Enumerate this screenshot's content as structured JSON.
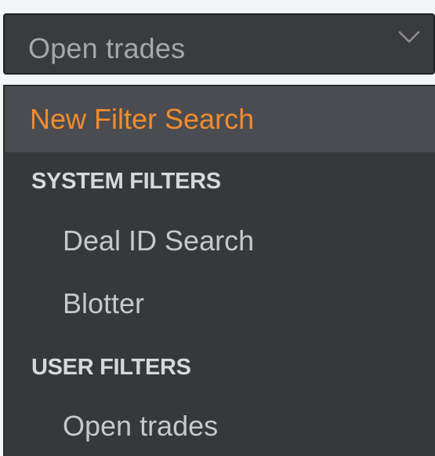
{
  "dropdown": {
    "selected_value": "Open trades",
    "chevron_icon": "chevron-down-icon"
  },
  "menu": {
    "new_filter_label": "New Filter Search",
    "sections": [
      {
        "title": "SYSTEM FILTERS",
        "items": [
          {
            "label": "Deal ID Search"
          },
          {
            "label": "Blotter"
          }
        ]
      },
      {
        "title": "USER FILTERS",
        "items": [
          {
            "label": "Open trades"
          }
        ]
      }
    ]
  },
  "colors": {
    "accent_orange": "#f08c2e",
    "menu_background": "#37383c",
    "highlight_background": "#4b4c51",
    "header_background": "#3a3b3f"
  }
}
